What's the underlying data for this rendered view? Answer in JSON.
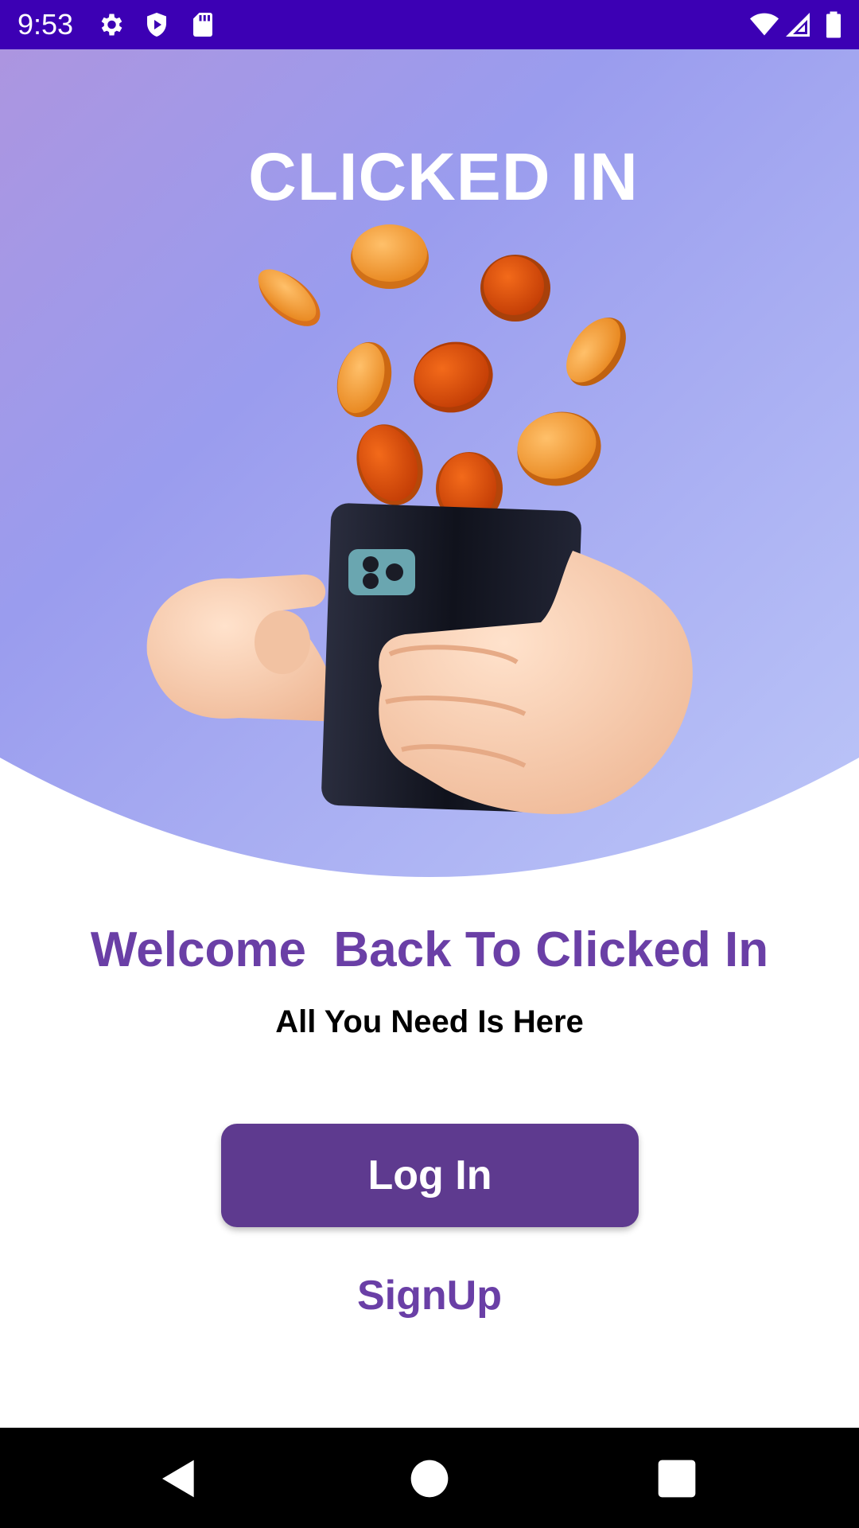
{
  "status_bar": {
    "time": "9:53",
    "left_icons": [
      "settings-icon",
      "shield-play-icon",
      "sd-card-icon"
    ],
    "right_icons": [
      "wifi-icon",
      "cellular-signal-icon",
      "battery-icon"
    ]
  },
  "header": {
    "app_title": "CLICKED IN"
  },
  "hero": {
    "illustration": "hand-holding-phone-with-coins",
    "gradient_colors": [
      "#ac95e0",
      "#9a9cee",
      "#bcc6f8"
    ]
  },
  "main": {
    "welcome_text": "Welcome  Back To Clicked In",
    "tagline": "All You Need Is Here",
    "login_label": "Log In",
    "signup_label": "SignUp"
  },
  "nav_bar": {
    "buttons": [
      "back-icon",
      "home-icon",
      "recents-icon"
    ]
  },
  "colors": {
    "status_bar": "#3c00b4",
    "accent_purple": "#6a3fa6",
    "button_purple": "#5e3a8f"
  }
}
